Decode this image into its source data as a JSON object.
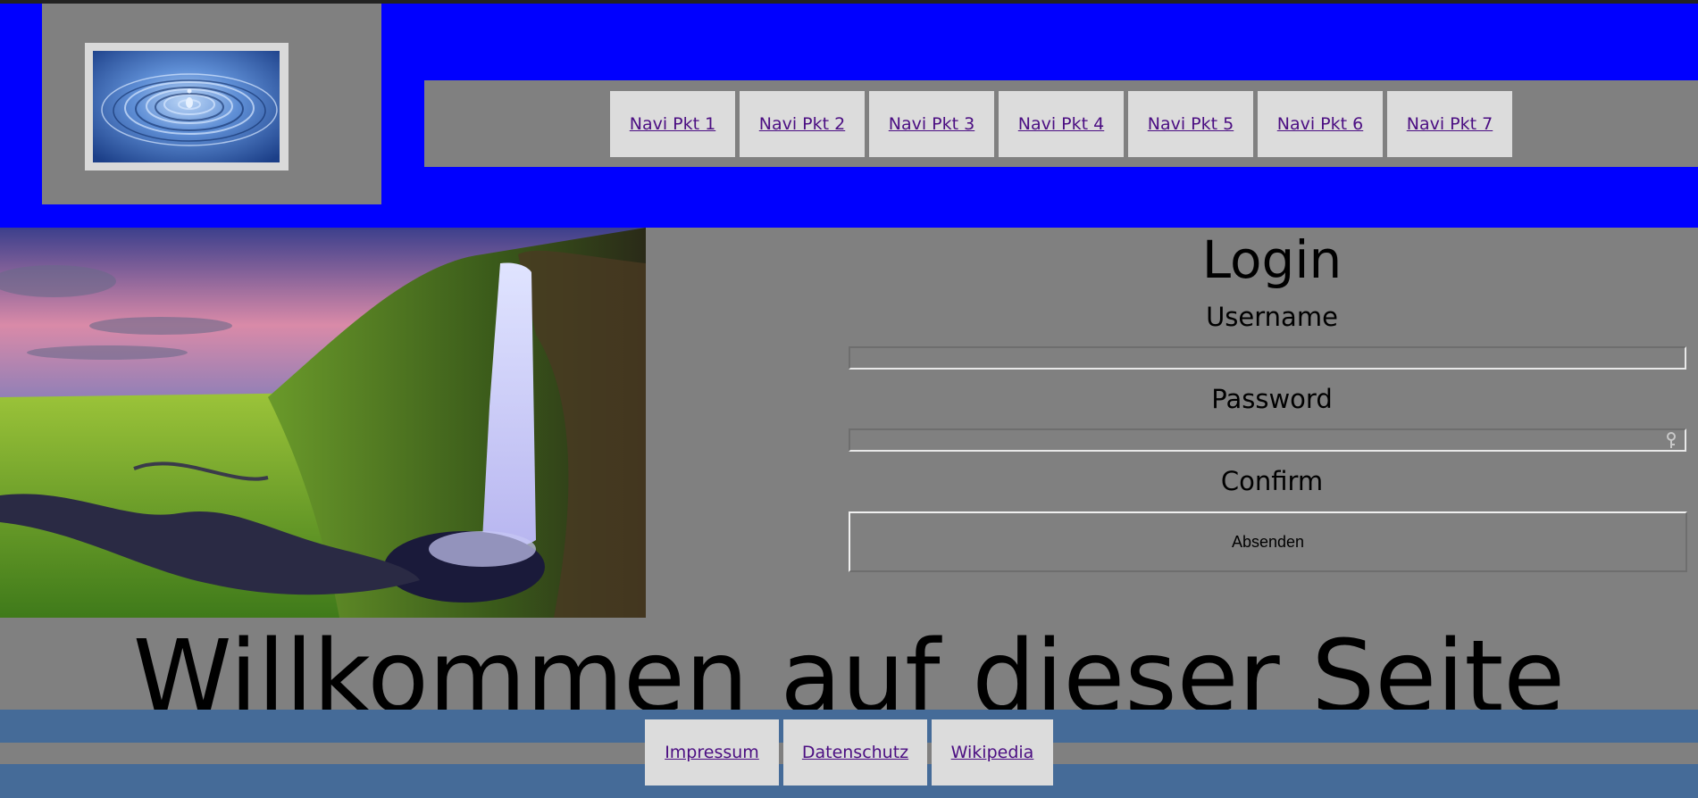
{
  "nav": {
    "items": [
      {
        "label": "Navi Pkt 1"
      },
      {
        "label": "Navi Pkt 2"
      },
      {
        "label": "Navi Pkt 3"
      },
      {
        "label": "Navi Pkt 4"
      },
      {
        "label": "Navi Pkt 5"
      },
      {
        "label": "Navi Pkt 6"
      },
      {
        "label": "Navi Pkt 7"
      }
    ]
  },
  "login": {
    "title": "Login",
    "username_label": "Username",
    "username_value": "",
    "password_label": "Password",
    "password_value": "",
    "confirm_label": "Confirm",
    "submit_label": "Absenden"
  },
  "main": {
    "welcome": "Willkommen auf dieser Seite"
  },
  "footer": {
    "items": [
      {
        "label": "Impressum"
      },
      {
        "label": "Datenschutz"
      },
      {
        "label": "Wikipedia"
      }
    ]
  },
  "colors": {
    "header_bg": "#0000ff",
    "page_bg": "#808080",
    "footer_bg": "#456b98",
    "link": "#4b0e82",
    "nav_item_bg": "#dcdcdc"
  },
  "icons": {
    "logo": "water-drop-image",
    "hero": "waterfall-landscape-image",
    "password_field": "key-icon"
  }
}
